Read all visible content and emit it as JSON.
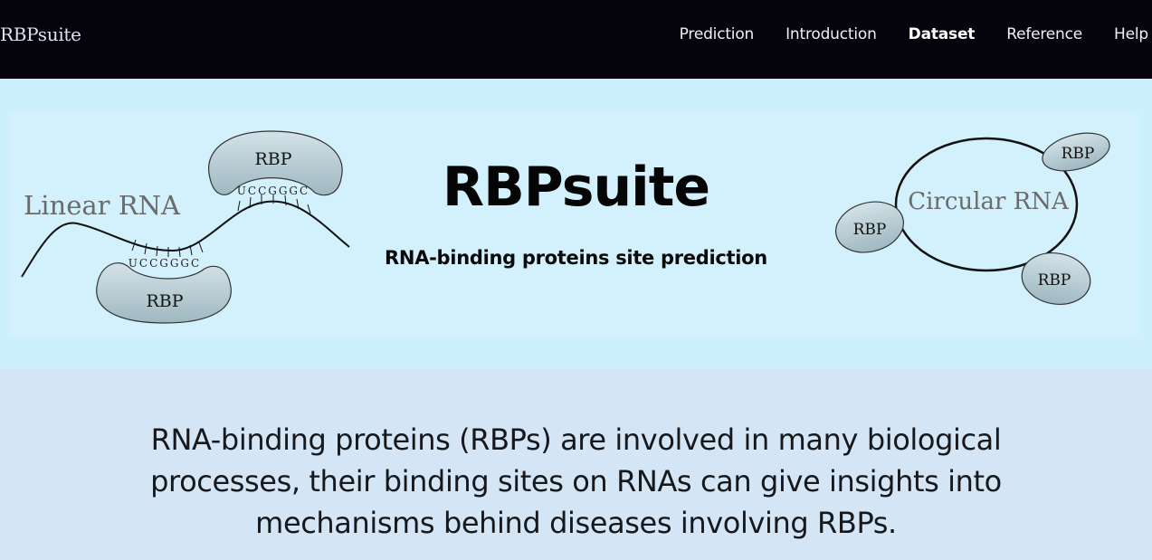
{
  "navbar": {
    "brand": "RBPsuite",
    "links": [
      {
        "label": "Prediction",
        "active": false
      },
      {
        "label": "Introduction",
        "active": false
      },
      {
        "label": "Dataset",
        "active": true
      },
      {
        "label": "Reference",
        "active": false
      },
      {
        "label": "Help",
        "active": false
      }
    ]
  },
  "hero": {
    "title": "RBPsuite",
    "subtitle": "RNA-binding proteins site prediction",
    "diagram": {
      "linear_label": "Linear RNA",
      "circular_label": "Circular RNA",
      "protein_label": "RBP",
      "motif_top": "UCCGGGC",
      "motif_bottom": "UCCGGGC"
    }
  },
  "intro": {
    "text": "RNA-binding proteins (RBPs) are involved in many biological processes, their binding sites on RNAs can give insights into mechanisms behind diseases involving RBPs."
  },
  "colors": {
    "navbar_bg": "#05040d",
    "hero_bg": "#cdf0fd",
    "intro_bg": "#d4e6f5",
    "protein_fill": "#b8cfd6"
  }
}
